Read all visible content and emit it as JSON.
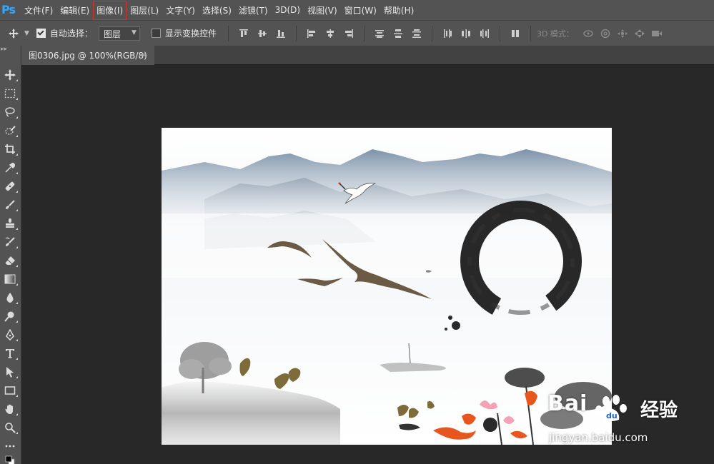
{
  "app": {
    "logo": "Ps"
  },
  "menu": [
    {
      "label": "文件(F)"
    },
    {
      "label": "编辑(E)"
    },
    {
      "label": "图像(I)",
      "highlighted": true
    },
    {
      "label": "图层(L)"
    },
    {
      "label": "文字(Y)"
    },
    {
      "label": "选择(S)"
    },
    {
      "label": "滤镜(T)"
    },
    {
      "label": "3D(D)"
    },
    {
      "label": "视图(V)"
    },
    {
      "label": "窗口(W)"
    },
    {
      "label": "帮助(H)"
    }
  ],
  "options": {
    "auto_select_label": "自动选择：",
    "auto_select_checked": true,
    "auto_select_target": "图层",
    "show_transform_label": "显示变换控件",
    "show_transform_checked": false,
    "mode3d_label": "3D 模式："
  },
  "document": {
    "tab_title": "图0306.jpg @ 100%(RGB/8)",
    "close_glyph": "×"
  },
  "tools": [
    "move-tool",
    "marquee-tool",
    "lasso-tool",
    "quick-select-tool",
    "crop-tool",
    "eyedropper-tool",
    "healing-brush-tool",
    "brush-tool",
    "clone-stamp-tool",
    "history-brush-tool",
    "eraser-tool",
    "gradient-tool",
    "blur-tool",
    "dodge-tool",
    "pen-tool",
    "type-tool",
    "path-select-tool",
    "rectangle-tool",
    "hand-tool",
    "zoom-tool",
    "more-tools"
  ],
  "watermark": {
    "brand": "Bai",
    "brand_cn": "经验",
    "url": "jingyan.baidu.com"
  },
  "colors": {
    "ui_panel": "#535353",
    "workspace": "#282828",
    "ps_blue": "#31a8ff",
    "menu_highlight": "#d63131"
  }
}
